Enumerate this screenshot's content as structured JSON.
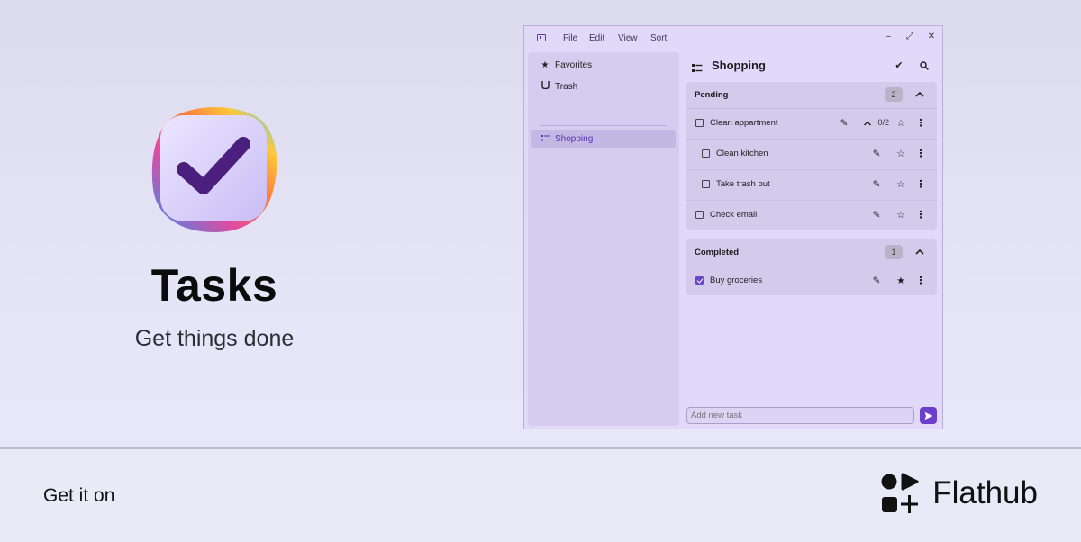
{
  "promo": {
    "app_name": "Tasks",
    "tagline": "Get things done"
  },
  "store_banner": {
    "get_it_on": "Get it on",
    "store_name": "Flathub"
  },
  "window": {
    "menu": [
      "File",
      "Edit",
      "View",
      "Sort"
    ],
    "controls": {
      "minimize": "–",
      "maximize": "⤢",
      "close": "✕"
    }
  },
  "sidebar": {
    "items": [
      {
        "label": "Favorites",
        "icon": "star-icon"
      },
      {
        "label": "Trash",
        "icon": "trash-icon"
      },
      {
        "label": "Shopping",
        "icon": "list-icon",
        "active": true
      }
    ]
  },
  "main": {
    "title": "Shopping",
    "groups": [
      {
        "title": "Pending",
        "count": "2",
        "tasks": [
          {
            "label": "Clean appartment",
            "sub_count": "0/2",
            "starred": false,
            "checked": false
          },
          {
            "label": "Clean kitchen",
            "starred": false,
            "checked": false,
            "subtask": true
          },
          {
            "label": "Take trash out",
            "starred": false,
            "checked": false,
            "subtask": true
          },
          {
            "label": "Check email",
            "starred": false,
            "checked": false
          }
        ]
      },
      {
        "title": "Completed",
        "count": "1",
        "tasks": [
          {
            "label": "Buy groceries",
            "starred": true,
            "checked": true
          }
        ]
      }
    ],
    "new_task_placeholder": "Add new task"
  },
  "colors": {
    "accent": "#6a3fcb",
    "window_bg": "#e1d8fa",
    "sidebar_bg": "#d6ccef"
  }
}
